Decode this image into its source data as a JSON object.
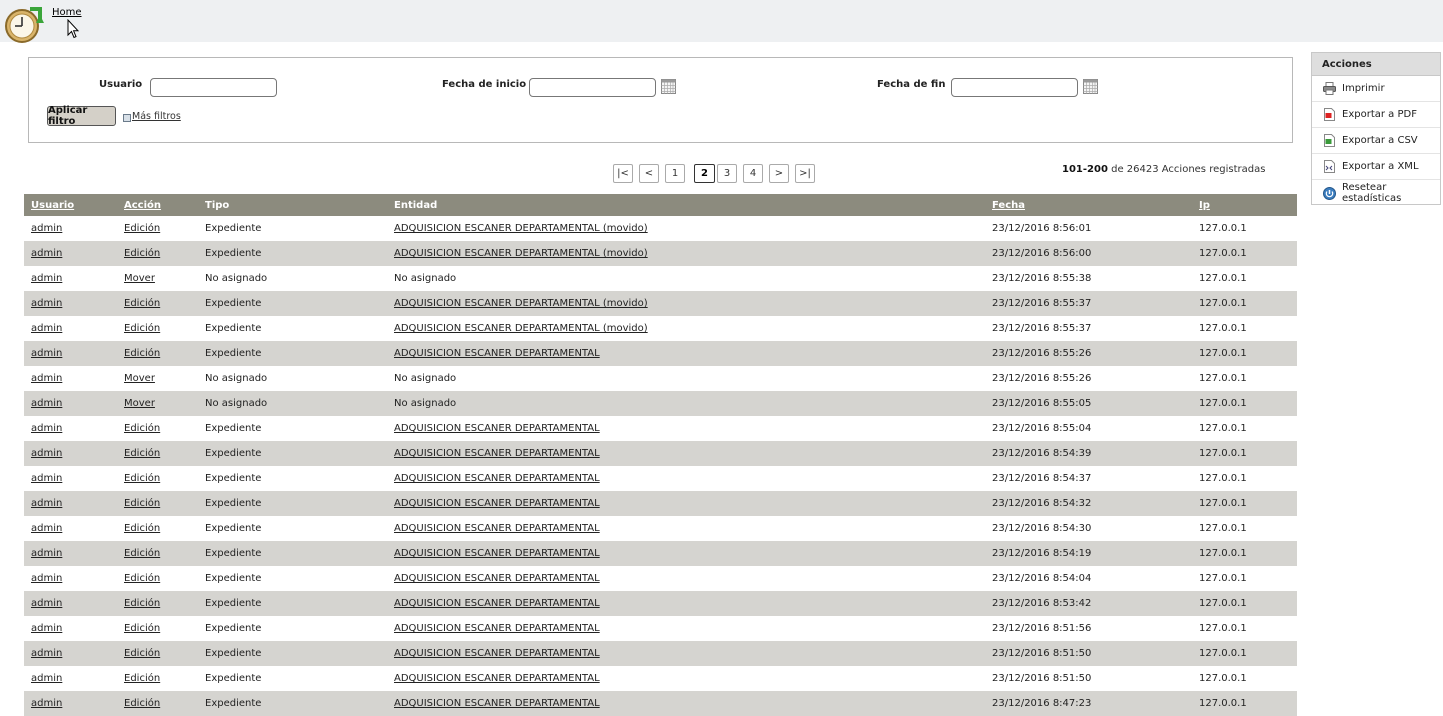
{
  "header": {
    "home_label": "Home"
  },
  "filters": {
    "usuario_label": "Usuario",
    "fecha_inicio_label": "Fecha de inicio",
    "fecha_fin_label": "Fecha de fin",
    "usuario_value": "",
    "fecha_inicio_value": "",
    "fecha_fin_value": "",
    "apply_label": "Aplicar filtro",
    "more_label": "Más filtros"
  },
  "pagination": {
    "first": "|<",
    "prev": "<",
    "pages": [
      "1",
      "2",
      "3",
      "4"
    ],
    "current_page": "2",
    "next": ">",
    "last": ">|",
    "range": "101-200",
    "of_text": "de 26423 Acciones registradas"
  },
  "table": {
    "headers": [
      "Usuario",
      "Acción",
      "Tipo",
      "Entidad",
      "Fecha",
      "Ip"
    ],
    "rows": [
      [
        "admin",
        "Edición",
        "Expediente",
        "ADQUISICION ESCANER DEPARTAMENTAL (movido)",
        "23/12/2016 8:56:01",
        "127.0.0.1"
      ],
      [
        "admin",
        "Edición",
        "Expediente",
        "ADQUISICION ESCANER DEPARTAMENTAL (movido)",
        "23/12/2016 8:56:00",
        "127.0.0.1"
      ],
      [
        "admin",
        "Mover",
        "No asignado",
        "No asignado",
        "23/12/2016 8:55:38",
        "127.0.0.1"
      ],
      [
        "admin",
        "Edición",
        "Expediente",
        "ADQUISICION ESCANER DEPARTAMENTAL (movido)",
        "23/12/2016 8:55:37",
        "127.0.0.1"
      ],
      [
        "admin",
        "Edición",
        "Expediente",
        "ADQUISICION ESCANER DEPARTAMENTAL (movido)",
        "23/12/2016 8:55:37",
        "127.0.0.1"
      ],
      [
        "admin",
        "Edición",
        "Expediente",
        "ADQUISICION ESCANER DEPARTAMENTAL",
        "23/12/2016 8:55:26",
        "127.0.0.1"
      ],
      [
        "admin",
        "Mover",
        "No asignado",
        "No asignado",
        "23/12/2016 8:55:26",
        "127.0.0.1"
      ],
      [
        "admin",
        "Mover",
        "No asignado",
        "No asignado",
        "23/12/2016 8:55:05",
        "127.0.0.1"
      ],
      [
        "admin",
        "Edición",
        "Expediente",
        "ADQUISICION ESCANER DEPARTAMENTAL",
        "23/12/2016 8:55:04",
        "127.0.0.1"
      ],
      [
        "admin",
        "Edición",
        "Expediente",
        "ADQUISICION ESCANER DEPARTAMENTAL",
        "23/12/2016 8:54:39",
        "127.0.0.1"
      ],
      [
        "admin",
        "Edición",
        "Expediente",
        "ADQUISICION ESCANER DEPARTAMENTAL",
        "23/12/2016 8:54:37",
        "127.0.0.1"
      ],
      [
        "admin",
        "Edición",
        "Expediente",
        "ADQUISICION ESCANER DEPARTAMENTAL",
        "23/12/2016 8:54:32",
        "127.0.0.1"
      ],
      [
        "admin",
        "Edición",
        "Expediente",
        "ADQUISICION ESCANER DEPARTAMENTAL",
        "23/12/2016 8:54:30",
        "127.0.0.1"
      ],
      [
        "admin",
        "Edición",
        "Expediente",
        "ADQUISICION ESCANER DEPARTAMENTAL",
        "23/12/2016 8:54:19",
        "127.0.0.1"
      ],
      [
        "admin",
        "Edición",
        "Expediente",
        "ADQUISICION ESCANER DEPARTAMENTAL",
        "23/12/2016 8:54:04",
        "127.0.0.1"
      ],
      [
        "admin",
        "Edición",
        "Expediente",
        "ADQUISICION ESCANER DEPARTAMENTAL",
        "23/12/2016 8:53:42",
        "127.0.0.1"
      ],
      [
        "admin",
        "Edición",
        "Expediente",
        "ADQUISICION ESCANER DEPARTAMENTAL",
        "23/12/2016 8:51:56",
        "127.0.0.1"
      ],
      [
        "admin",
        "Edición",
        "Expediente",
        "ADQUISICION ESCANER DEPARTAMENTAL",
        "23/12/2016 8:51:50",
        "127.0.0.1"
      ],
      [
        "admin",
        "Edición",
        "Expediente",
        "ADQUISICION ESCANER DEPARTAMENTAL",
        "23/12/2016 8:51:50",
        "127.0.0.1"
      ],
      [
        "admin",
        "Edición",
        "Expediente",
        "ADQUISICION ESCANER DEPARTAMENTAL",
        "23/12/2016 8:47:23",
        "127.0.0.1"
      ]
    ]
  },
  "actions_panel": {
    "title": "Acciones",
    "items": [
      {
        "label": "Imprimir",
        "icon": "printer-icon"
      },
      {
        "label": "Exportar a PDF",
        "icon": "pdf-icon"
      },
      {
        "label": "Exportar a CSV",
        "icon": "csv-icon"
      },
      {
        "label": "Exportar a XML",
        "icon": "xml-icon"
      },
      {
        "label": "Resetear estadísticas",
        "icon": "reset-icon"
      }
    ]
  },
  "colors": {
    "header_bg": "#8c8b7e",
    "row_alt": "#d5d4d0",
    "topbar_bg": "#eef0f2",
    "logo_green": "#3aa53a",
    "logo_gold": "#c89a3a"
  }
}
